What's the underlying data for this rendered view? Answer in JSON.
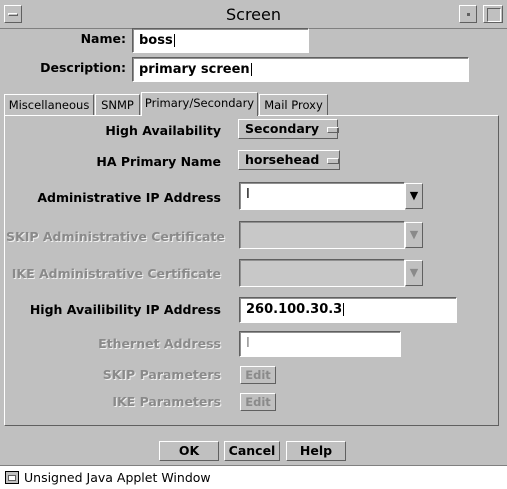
{
  "window": {
    "title": "Screen",
    "status_text": "Unsigned Java Applet Window"
  },
  "header": {
    "name_label": "Name:",
    "name_value": "boss",
    "description_label": "Description:",
    "description_value": "primary screen"
  },
  "tabs": [
    {
      "label": "Miscellaneous",
      "active": false
    },
    {
      "label": "SNMP",
      "active": false
    },
    {
      "label": "Primary/Secondary",
      "active": true
    },
    {
      "label": "Mail Proxy",
      "active": false
    }
  ],
  "panel": {
    "high_availability": {
      "label": "High Availability",
      "value": "Secondary"
    },
    "ha_primary_name": {
      "label": "HA Primary Name",
      "value": "horsehead"
    },
    "admin_ip": {
      "label": "Administrative IP Address",
      "value": ""
    },
    "skip_cert": {
      "label": "SKIP Administrative Certificate",
      "value": ""
    },
    "ike_cert": {
      "label": "IKE Administrative Certificate",
      "value": ""
    },
    "ha_ip": {
      "label": "High Availibility IP Address",
      "value": "260.100.30.3"
    },
    "ethernet": {
      "label": "Ethernet Address",
      "value": ""
    },
    "skip_params": {
      "label": "SKIP Parameters",
      "button": "Edit"
    },
    "ike_params": {
      "label": "IKE Parameters",
      "button": "Edit"
    }
  },
  "buttons": {
    "ok": "OK",
    "cancel": "Cancel",
    "help": "Help"
  }
}
